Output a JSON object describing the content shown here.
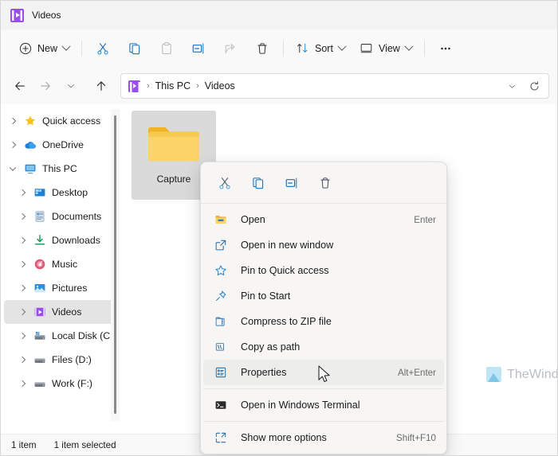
{
  "window": {
    "title": "Videos",
    "title_icon": "videos-folder-icon"
  },
  "toolbar": {
    "new_label": "New",
    "sort_label": "Sort",
    "view_label": "View",
    "items": [
      {
        "name": "cut-icon",
        "enabled": true
      },
      {
        "name": "copy-icon",
        "enabled": true
      },
      {
        "name": "paste-icon",
        "enabled": false
      },
      {
        "name": "rename-icon",
        "enabled": true
      },
      {
        "name": "share-icon",
        "enabled": false
      },
      {
        "name": "delete-icon",
        "enabled": true
      }
    ],
    "more_label": "•••"
  },
  "addressbar": {
    "crumbs": [
      "This PC",
      "Videos"
    ],
    "separator": "›",
    "icon": "videos-folder-icon",
    "dropdown_icon": "chevron-down-icon",
    "refresh_icon": "refresh-icon",
    "back_icon": "arrow-left-icon",
    "forward_icon": "arrow-right-icon",
    "recent_icon": "chevron-down-icon",
    "up_icon": "arrow-up-icon"
  },
  "sidebar": {
    "items": [
      {
        "label": "Quick access",
        "icon": "star-icon",
        "indent": false,
        "expanded": false,
        "selected": false
      },
      {
        "label": "OneDrive",
        "icon": "cloud-icon",
        "indent": false,
        "expanded": false,
        "selected": false
      },
      {
        "label": "This PC",
        "icon": "monitor-icon",
        "indent": false,
        "expanded": true,
        "selected": false
      },
      {
        "label": "Desktop",
        "icon": "desktop-icon",
        "indent": true,
        "expanded": false,
        "selected": false
      },
      {
        "label": "Documents",
        "icon": "documents-icon",
        "indent": true,
        "expanded": false,
        "selected": false
      },
      {
        "label": "Downloads",
        "icon": "downloads-icon",
        "indent": true,
        "expanded": false,
        "selected": false
      },
      {
        "label": "Music",
        "icon": "music-icon",
        "indent": true,
        "expanded": false,
        "selected": false
      },
      {
        "label": "Pictures",
        "icon": "pictures-icon",
        "indent": true,
        "expanded": false,
        "selected": false
      },
      {
        "label": "Videos",
        "icon": "videos-icon",
        "indent": true,
        "expanded": false,
        "selected": true
      },
      {
        "label": "Local Disk (C:)",
        "icon": "local-disk-icon",
        "indent": true,
        "expanded": false,
        "selected": false
      },
      {
        "label": "Files (D:)",
        "icon": "drive-icon",
        "indent": true,
        "expanded": false,
        "selected": false
      },
      {
        "label": "Work (F:)",
        "icon": "drive-icon",
        "indent": true,
        "expanded": false,
        "selected": false
      }
    ]
  },
  "content": {
    "folder": {
      "name": "Capture",
      "icon": "folder-icon",
      "selected": true
    }
  },
  "context_menu": {
    "tools": [
      {
        "name": "cut-icon",
        "label": "Cut"
      },
      {
        "name": "copy-icon",
        "label": "Copy"
      },
      {
        "name": "rename-icon",
        "label": "Rename"
      },
      {
        "name": "delete-icon",
        "label": "Delete"
      }
    ],
    "items": [
      {
        "label": "Open",
        "accel": "Enter",
        "icon": "folder-open-icon",
        "hover": false,
        "divider_after": false
      },
      {
        "label": "Open in new window",
        "accel": "",
        "icon": "new-window-icon",
        "hover": false,
        "divider_after": false
      },
      {
        "label": "Pin to Quick access",
        "accel": "",
        "icon": "star-outline-icon",
        "hover": false,
        "divider_after": false
      },
      {
        "label": "Pin to Start",
        "accel": "",
        "icon": "pin-icon",
        "hover": false,
        "divider_after": false
      },
      {
        "label": "Compress to ZIP file",
        "accel": "",
        "icon": "zip-icon",
        "hover": false,
        "divider_after": false
      },
      {
        "label": "Copy as path",
        "accel": "",
        "icon": "copy-path-icon",
        "hover": false,
        "divider_after": false
      },
      {
        "label": "Properties",
        "accel": "Alt+Enter",
        "icon": "properties-icon",
        "hover": true,
        "divider_after": true
      },
      {
        "label": "Open in Windows Terminal",
        "accel": "",
        "icon": "terminal-icon",
        "hover": false,
        "divider_after": true
      },
      {
        "label": "Show more options",
        "accel": "Shift+F10",
        "icon": "more-options-icon",
        "hover": false,
        "divider_after": false
      }
    ]
  },
  "watermark": {
    "text": "TheWindowsClub",
    "icon": "mountain-icon"
  },
  "statusbar": {
    "item_count": "1 item",
    "selection": "1 item selected"
  },
  "colors": {
    "accent_blue": "#0f6cbd",
    "folder_yellow": "#f6c344",
    "videos_purple": "#9b4dea",
    "selection_gray": "#e4e4e4"
  }
}
